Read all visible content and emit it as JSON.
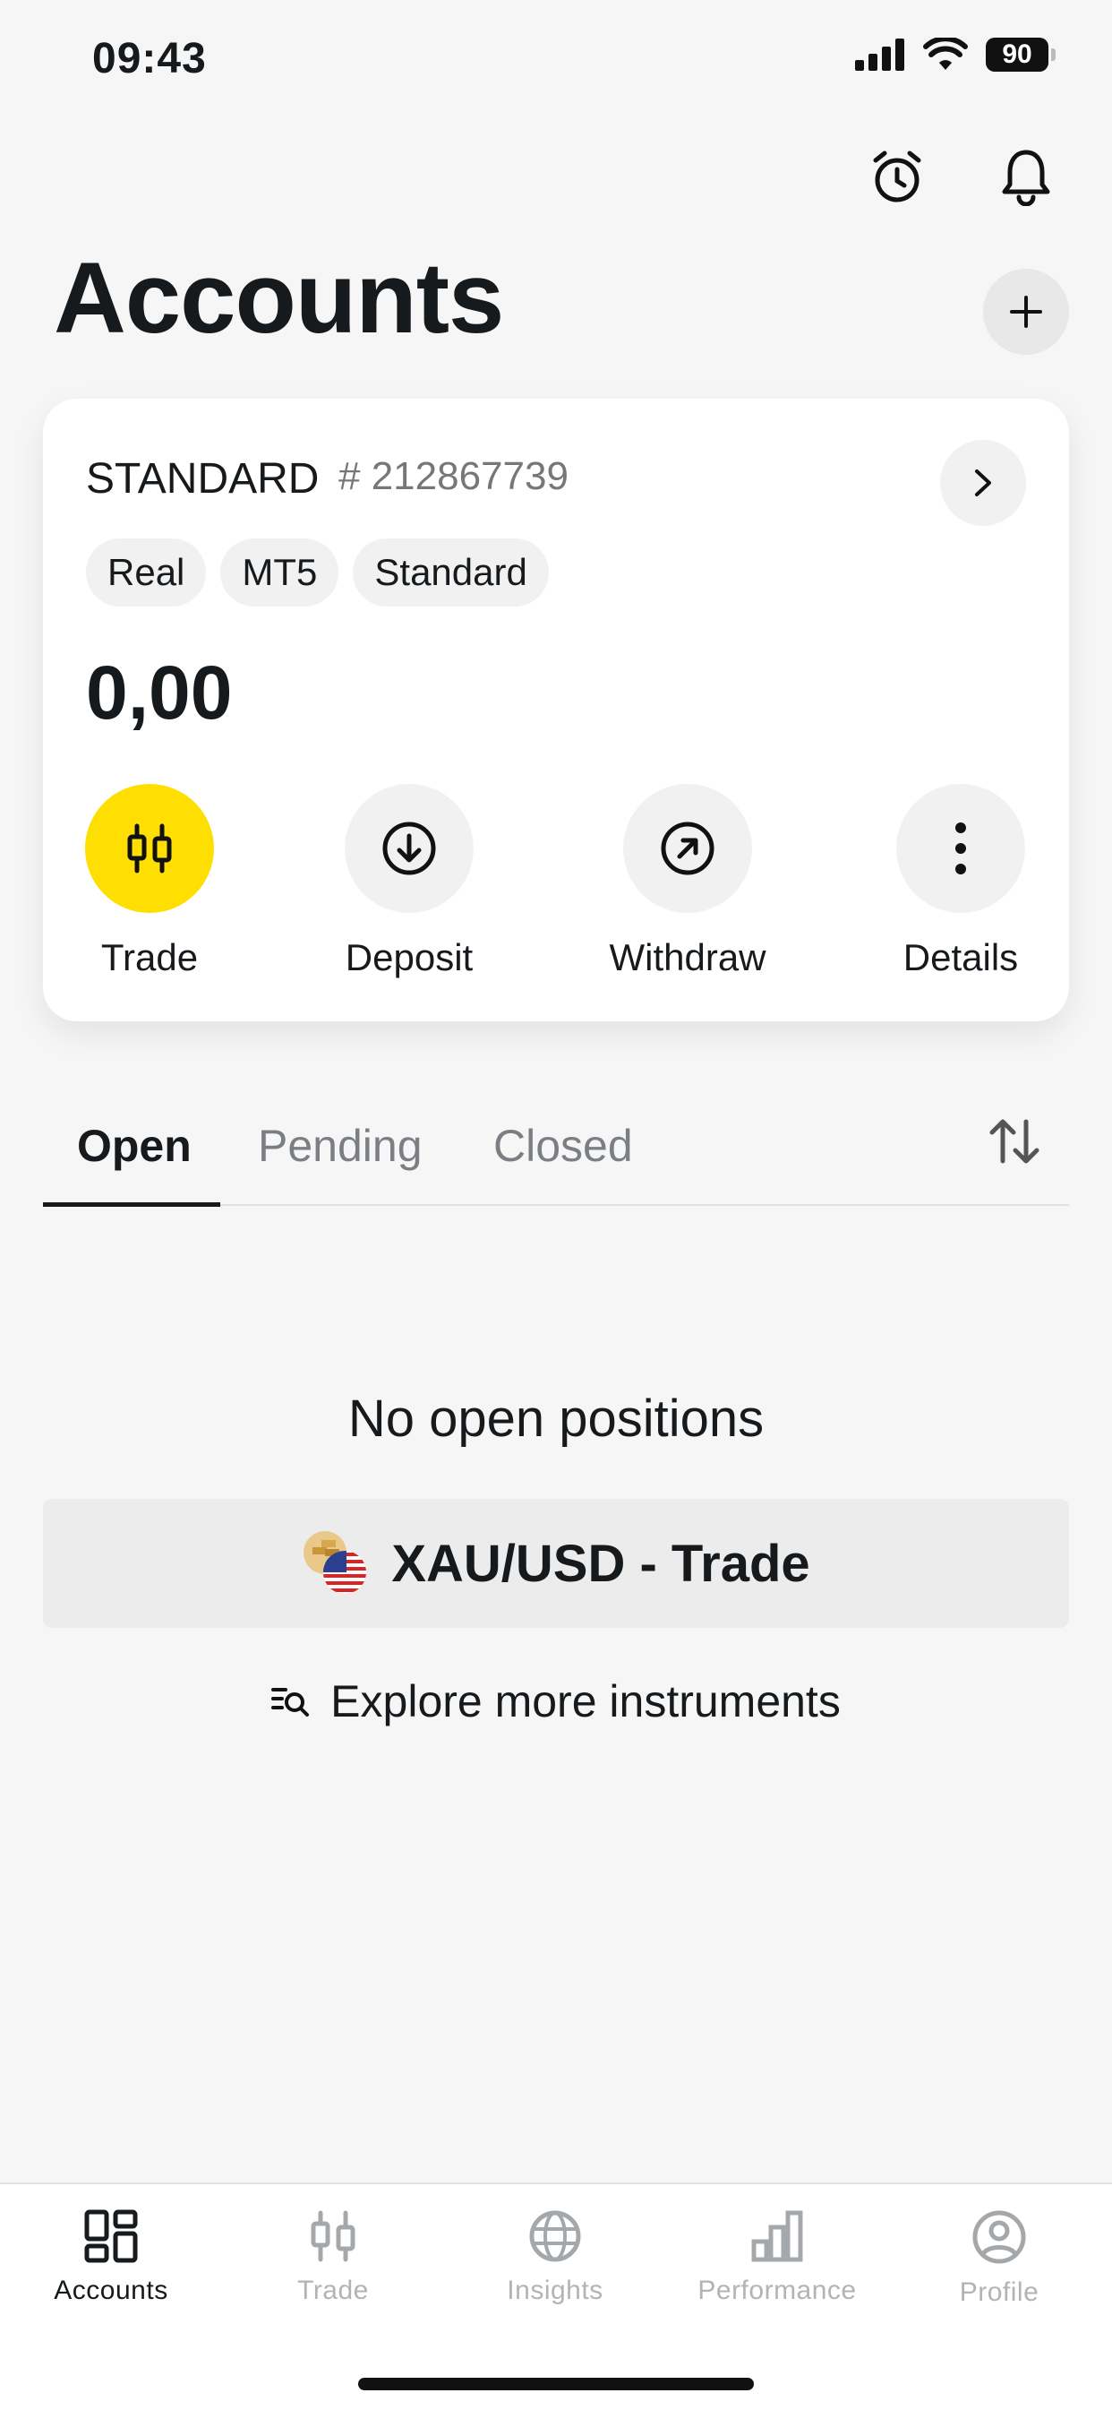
{
  "status_bar": {
    "time": "09:43",
    "battery": "90"
  },
  "header": {
    "title": "Accounts"
  },
  "account": {
    "type": "STANDARD",
    "number": "# 212867739",
    "chips": [
      "Real",
      "MT5",
      "Standard"
    ],
    "balance": "0,00",
    "actions": {
      "trade": "Trade",
      "deposit": "Deposit",
      "withdraw": "Withdraw",
      "details": "Details"
    }
  },
  "tabs": {
    "open": "Open",
    "pending": "Pending",
    "closed": "Closed"
  },
  "empty_state": {
    "message": "No open positions",
    "trade_button": "XAU/USD - Trade",
    "explore_link": "Explore more instruments"
  },
  "bottom_nav": {
    "accounts": "Accounts",
    "trade": "Trade",
    "insights": "Insights",
    "performance": "Performance",
    "profile": "Profile"
  },
  "colors": {
    "accent": "#ffde02",
    "text": "#161a1d",
    "background": "#f6f6f6"
  },
  "icons": [
    "signal-icon",
    "wifi-icon",
    "alarm-clock-icon",
    "bell-icon",
    "plus-icon",
    "chevron-right-icon",
    "candlestick-icon",
    "download-circle-icon",
    "arrow-up-right-circle-icon",
    "more-vertical-icon",
    "sort-icon",
    "gold-usd-flag-icon",
    "search-list-icon",
    "grid-icon",
    "globe-icon",
    "bar-chart-icon",
    "user-circle-icon"
  ]
}
